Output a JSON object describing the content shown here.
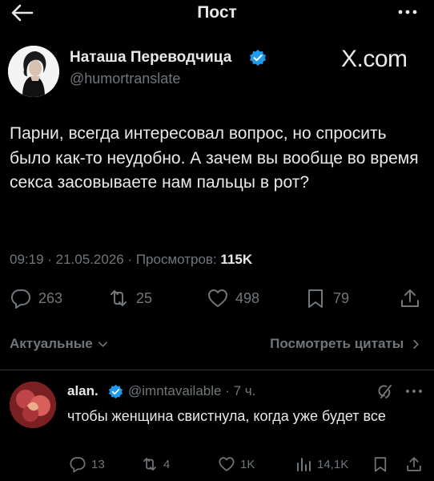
{
  "header": {
    "title": "Пост",
    "back_icon": "arrow-left-icon",
    "more_icon": "more-horizontal-icon"
  },
  "author": {
    "name": "Наташа Переводчица",
    "handle": "@humortranslate",
    "verified": true,
    "badge_color": "#1d9bf0"
  },
  "watermark": "X.com",
  "tweet": {
    "text": "Парни, всегда интересовал вопрос, но спросить было как-то неудобно. А зачем вы вообще во время секса засовываете нам пальцы в рот?",
    "meta_prefix": "09:19 · 21.05.2026 · Просмотров: ",
    "views": "115K"
  },
  "actions": {
    "replies": "263",
    "reposts": "25",
    "likes": "498",
    "bookmarks": "79"
  },
  "replies_bar": {
    "sort_label": "Актуальные",
    "quotes_label": "Посмотреть цитаты"
  },
  "reply": {
    "name": "alan.",
    "verified": true,
    "handle_time": "@imntavailable · 7 ч.",
    "text": "чтобы женщина свистнула, когда уже будет все",
    "replies": "13",
    "reposts": "4",
    "likes": "1K",
    "views": "14,1K"
  },
  "colors": {
    "background": "#000000",
    "text": "#e7e9ea",
    "muted": "#71767b",
    "divider": "#2f3336",
    "accent": "#1d9bf0"
  }
}
